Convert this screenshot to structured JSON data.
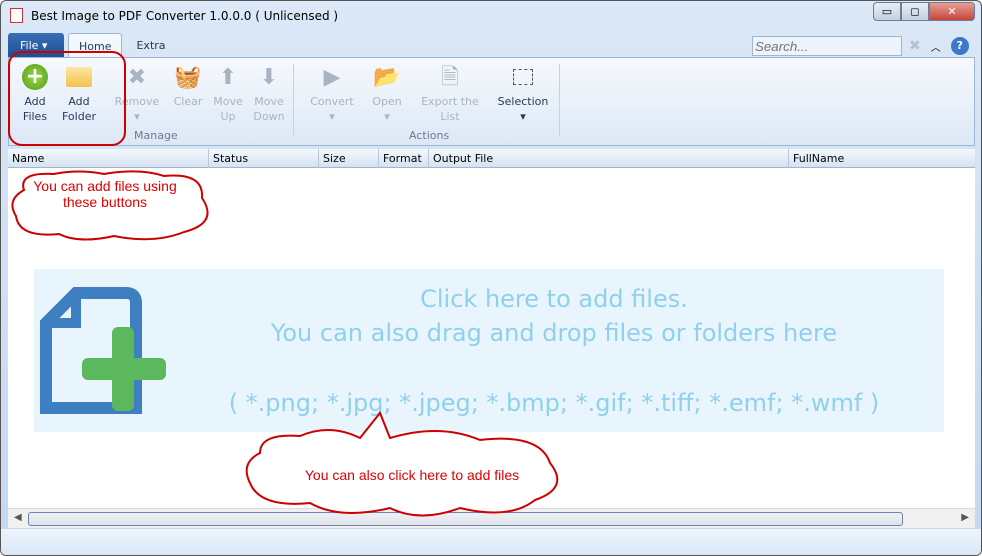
{
  "window": {
    "title": "Best Image to PDF Converter 1.0.0.0  ( Unlicensed )",
    "minimize": "▭",
    "maximize": "◻",
    "close": "✕"
  },
  "menu": {
    "file": "File ▾",
    "tabs": [
      "Home",
      "Extra"
    ]
  },
  "search": {
    "placeholder": "Search..."
  },
  "help": "?",
  "ribbon": {
    "buttons": [
      {
        "label1": "Add",
        "label2": "Files"
      },
      {
        "label1": "Add",
        "label2": "Folder"
      },
      {
        "label1": "Remove",
        "label2": ""
      },
      {
        "label1": "Clear",
        "label2": ""
      },
      {
        "label1": "Move",
        "label2": "Up"
      },
      {
        "label1": "Move",
        "label2": "Down"
      },
      {
        "label1": "Convert",
        "label2": ""
      },
      {
        "label1": "Open",
        "label2": ""
      },
      {
        "label1": "Export the",
        "label2": "List"
      },
      {
        "label1": "Selection",
        "label2": ""
      }
    ],
    "groups": [
      "Manage",
      "Actions"
    ]
  },
  "columns": [
    "Name",
    "Status",
    "Size",
    "Format",
    "Output File",
    "FullName"
  ],
  "dropzone": {
    "line1": "Click here to add files.",
    "line2": "You can also drag and drop files or folders here",
    "line3": "( *.png; *.jpg; *.jpeg; *.bmp; *.gif; *.tiff; *.emf; *.wmf )"
  },
  "callouts": {
    "buttons": "You can add files using these buttons",
    "dropzone": "You can also click here to add files"
  }
}
